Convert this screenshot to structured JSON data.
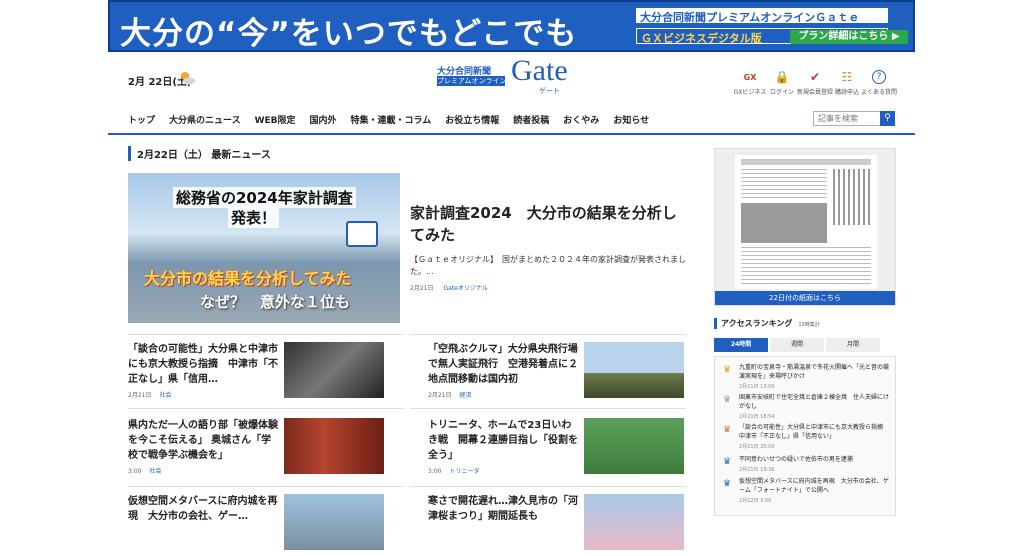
{
  "banner": {
    "headline": "大分の“今”をいつでもどこでも",
    "brand": "大分合同新聞プレミアムオンラインＧａｔｅ",
    "sub": "ＧＸビジネスデジタル版",
    "cta": "プラン詳細はこちら ▶"
  },
  "header": {
    "date": "2月 22日(土)",
    "weather_icon": "sun-cloud-icon",
    "logo_top": "大分合同新聞",
    "logo_mid": "プレミアムオンライン",
    "logo_gate": "Gate",
    "logo_kana": "ゲート",
    "tools": [
      {
        "label": "GXビジネス",
        "icon": "gx-icon"
      },
      {
        "label": "ログイン",
        "icon": "lock-icon"
      },
      {
        "label": "新規会員登録",
        "icon": "check-circle-icon"
      },
      {
        "label": "購読申込",
        "icon": "newspaper-icon"
      },
      {
        "label": "よくある質問",
        "icon": "question-icon"
      }
    ]
  },
  "nav": [
    "トップ",
    "大分県のニュース",
    "WEB限定",
    "国内外",
    "特集・連載・コラム",
    "お役立ち情報",
    "読者投稿",
    "おくやみ",
    "お知らせ"
  ],
  "search": {
    "placeholder": "記事を検索"
  },
  "section_title": "2月22日（土） 最新ニュース",
  "hero": {
    "image_line1": "総務省の2024年家計調査",
    "image_line2": "発表！",
    "image_line3": "大分市の結果を分析してみた",
    "image_line4": "なぜ？　意外な１位も",
    "title": "家計調査2024　大分市の結果を分析してみた",
    "desc": "【Ｇａｔｅオリジナル】　国がまとめた２０２４年の家計調査が発表されました。...",
    "date": "2月21日",
    "category": "Gateオリジナル"
  },
  "articles": [
    {
      "title": "「談合の可能性」大分県と中津市にも京大教授ら指摘　中津市「不正なし」県「信用…",
      "date": "2月21日",
      "category": "社会"
    },
    {
      "title": "「空飛ぶクルマ」大分県央飛行場で無人実証飛行　空港発着点に２地点間移動は国内初",
      "date": "2月21日",
      "category": "経済"
    },
    {
      "title": "県内ただ一人の語り部「被爆体験を今こそ伝える」 奥城さん「学校で戦争学ぶ機会を」",
      "date": "3:00",
      "category": "社会"
    },
    {
      "title": "トリニータ、ホームで23日いわき戦　開幕２連勝目指し「役割を全う」",
      "date": "3:00",
      "category": "トリニータ"
    },
    {
      "title": "仮想空間メタバースに府内城を再現　大分市の会社、ゲー…",
      "date": "",
      "category": ""
    },
    {
      "title": "寒さで開花遅れ…津久見市の「河津桜まつり」期間延長も",
      "date": "",
      "category": ""
    }
  ],
  "paper": {
    "caption": "22日付の紙面はこちら"
  },
  "ranking": {
    "title": "アクセスランキング",
    "updated": "13時集計",
    "tabs": [
      "24時間",
      "週間",
      "月間"
    ],
    "items": [
      {
        "text": "九重町の宝泉寺・筋湯温泉で冬花火開催へ「光と音の競演実現を」来場呼びかけ",
        "date": "2月21日 13:00"
      },
      {
        "text": "国東市安岐町で住宅全焼と倉庫２棟全焼　住人夫婦にけがなし",
        "date": "2月21日 18:54"
      },
      {
        "text": "「談合の可能性」大分県と中津市にも京大教授ら指摘　中津市「不正なし」県「信用ない」",
        "date": "2月21日 20:00"
      },
      {
        "text": "不同意わいせつの疑いで佐伯市の男を逮捕",
        "date": "2月21日 19:36"
      },
      {
        "text": "仮想空間メタバースに府内城を再現　大分市の会社、ゲーム「フォートナイト」で公開へ",
        "date": "2月22日 3:00"
      }
    ]
  },
  "colors": {
    "brand": "#1f5fbf",
    "accent_yellow": "#ffd84a",
    "cta_green": "#2aa84a"
  }
}
